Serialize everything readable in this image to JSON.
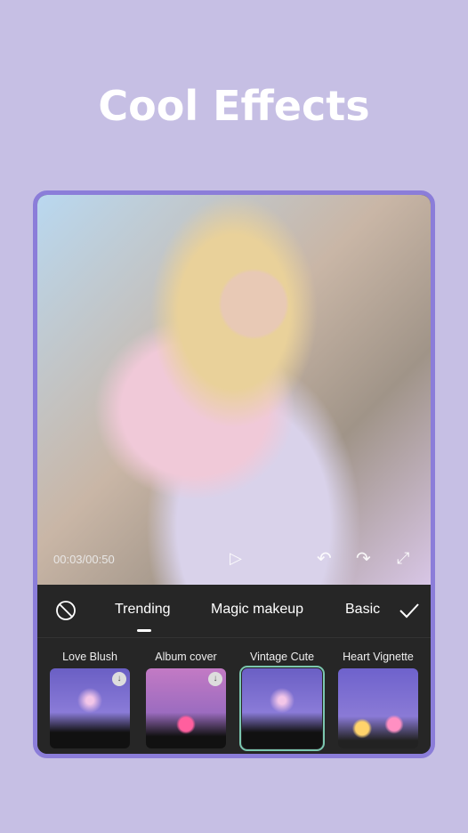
{
  "headline": "Cool Effects",
  "player": {
    "time": "00:03/00:50"
  },
  "tabs": {
    "none_icon": "prohibited-icon",
    "items": [
      "Trending",
      "Magic makeup",
      "Basic"
    ],
    "active": "Trending",
    "confirm_icon": "check-icon"
  },
  "effects": [
    {
      "label": "Love Blush",
      "download": true,
      "selected": false
    },
    {
      "label": "Album cover",
      "download": true,
      "selected": false
    },
    {
      "label": "Vintage Cute",
      "download": false,
      "selected": true
    },
    {
      "label": "Heart Vignette",
      "download": false,
      "selected": false
    }
  ],
  "colors": {
    "background": "#c6bfe4",
    "frame": "#8b7dd9",
    "panel": "#262626",
    "selected": "#7bc7b0"
  }
}
